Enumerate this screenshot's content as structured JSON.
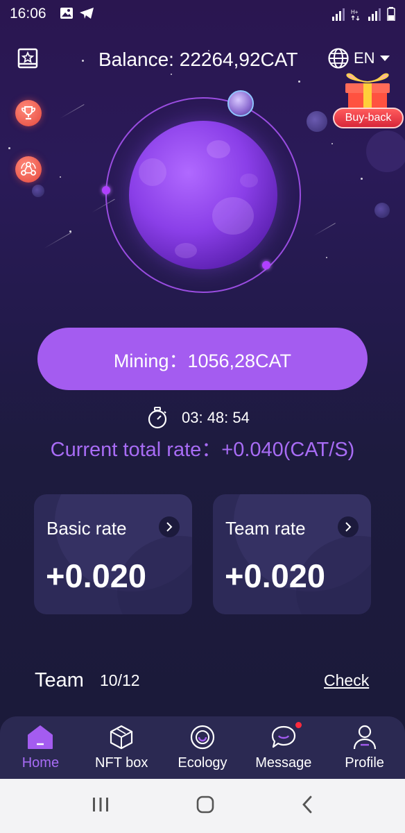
{
  "status_bar": {
    "time": "16:06"
  },
  "header": {
    "balance": "Balance: 22264,92CAT",
    "language": "EN"
  },
  "buyback_label": "Buy-back",
  "mining": {
    "label": "Mining：1056,28CAT"
  },
  "timer": {
    "value": "03: 48: 54"
  },
  "total_rate": "Current total rate：+0.040(CAT/S)",
  "cards": [
    {
      "title": "Basic rate",
      "value": "+0.020"
    },
    {
      "title": "Team rate",
      "value": "+0.020"
    }
  ],
  "team": {
    "label": "Team",
    "count": "10/12",
    "link": "Check"
  },
  "nav": [
    {
      "label": "Home",
      "icon": "home-icon",
      "active": true
    },
    {
      "label": "NFT box",
      "icon": "box-icon",
      "active": false
    },
    {
      "label": "Ecology",
      "icon": "ecology-icon",
      "active": false
    },
    {
      "label": "Message",
      "icon": "message-icon",
      "active": false,
      "badge": true
    },
    {
      "label": "Profile",
      "icon": "profile-icon",
      "active": false
    }
  ],
  "colors": {
    "accent": "#a45cf0",
    "accent_text": "#a86cf5",
    "card": "#2d2a58",
    "badge": "#ff2b3d"
  }
}
